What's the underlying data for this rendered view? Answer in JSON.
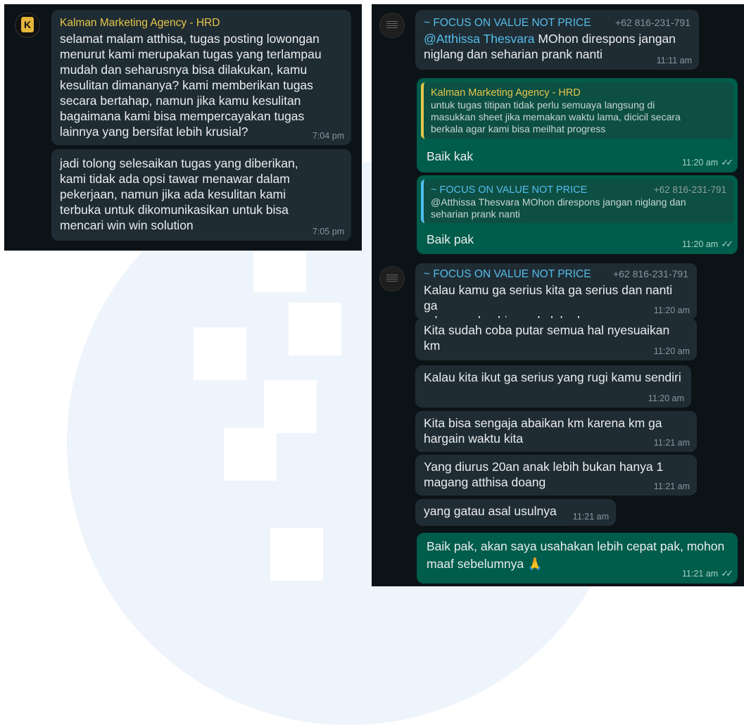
{
  "left_chat": {
    "messages": [
      {
        "sender": "Kalman Marketing Agency - HRD",
        "text": "selamat malam atthisa, tugas posting lowongan\nmenurut kami merupakan tugas yang terlampau\nmudah dan seharusnya bisa dilakukan, kamu\nkesulitan dimananya? kami memberikan tugas\nsecara bertahap, namun jika kamu kesulitan\nbagaimana kami bisa mempercayakan tugas\nlainnya yang bersifat lebih krusial?",
        "time": "7:04 pm"
      },
      {
        "text": "jadi tolong selesaikan tugas yang diberikan,\nkami tidak ada opsi tawar menawar dalam\npekerjaan, namun jika ada kesulitan kami\nterbuka untuk dikomunikasikan untuk bisa\nmencari win win solution",
        "time": "7:05 pm"
      }
    ]
  },
  "right_chat": {
    "m1": {
      "sender": "~ FOCUS ON VALUE NOT PRICE",
      "phone": "+62 816-231-791",
      "mention": "@Atthissa Thesvara",
      "text_line1": " MOhon direspons jangan",
      "text_line2": "niglang dan seharian prank nanti",
      "time": "11:11 am"
    },
    "m2": {
      "quote_sender": "Kalman Marketing Agency - HRD",
      "quote_text": "untuk tugas titipan tidak perlu semuaya langsung di\nmasukkan sheet jika memakan waktu lama, dicicil secara\nberkala agar kami bisa meilhat progress",
      "text": "Baik kak",
      "time": "11:20 am"
    },
    "m3": {
      "quote_sender": "~ FOCUS ON VALUE NOT PRICE",
      "quote_phone": "+62 816-231-791",
      "quote_text": "@Atthissa Thesvara MOhon direspons jangan niglang dan\nseharian prank nanti",
      "text": "Baik pak",
      "time": "11:20 am"
    },
    "m4": {
      "sender": "~ FOCUS ON VALUE NOT PRICE",
      "phone": "+62 816-231-791",
      "text": "Kalau kamu ga serius kita ga serius dan nanti ga\nada yang km bisa pakek kedepannya",
      "time": "11:20 am"
    },
    "m5": {
      "text": "Kita sudah coba putar semua hal nyesuaikan km",
      "time": "11:20 am"
    },
    "m6": {
      "text": "Kalau kita ikut ga serius yang rugi kamu sendiri",
      "time": "11:20 am"
    },
    "m7": {
      "text": "Kita bisa sengaja abaikan km karena km ga\nhargain waktu kita",
      "time": "11:21 am"
    },
    "m8": {
      "text": "Yang diurus 20an anak lebih bukan hanya 1\nmagang atthisa doang",
      "time": "11:21 am"
    },
    "m9": {
      "text": "yang gatau asal usulnya",
      "time": "11:21 am"
    },
    "m10": {
      "text": "Baik pak, akan saya usahakan lebih cepat pak, mohon\nmaaf sebelumnya 🙏",
      "time": "11:21 am"
    }
  },
  "icons": {
    "read_ticks": "double-check",
    "kalman_logo": "K"
  },
  "colors": {
    "panel_bg": "#0c1317",
    "incoming_bubble": "#202c33",
    "outgoing_bubble": "#005c4b",
    "hrd_name": "#e5c74a",
    "focus_name": "#53bdeb",
    "timestamp": "#8696a0"
  }
}
